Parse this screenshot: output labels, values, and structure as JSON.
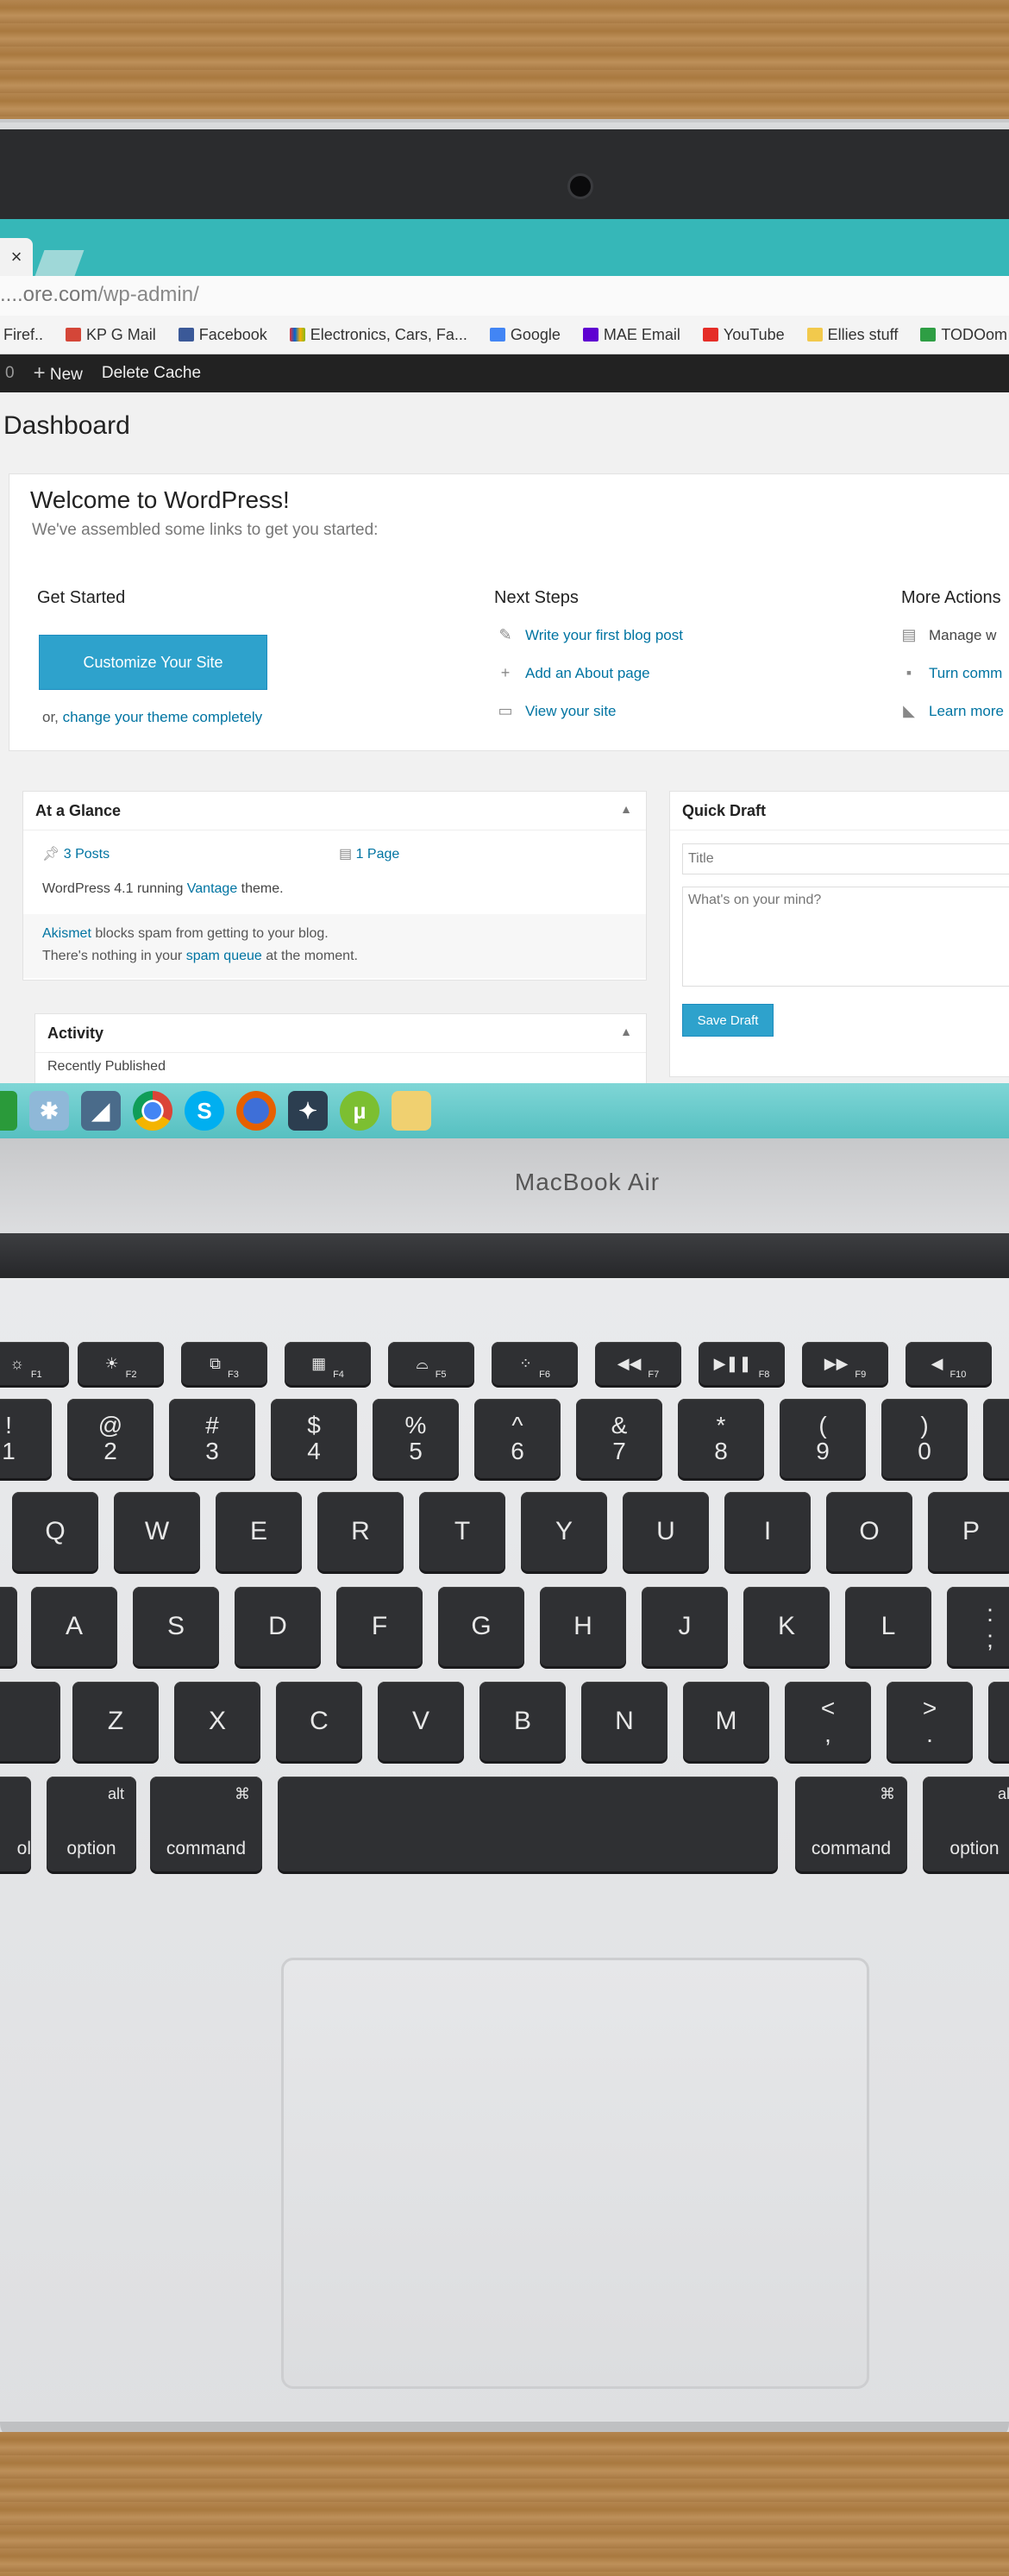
{
  "browser": {
    "tab_close": "×",
    "url_host": "....ore.com",
    "url_path": "/wp-admin/",
    "bookmarks": [
      {
        "label": "Firef..",
        "icon": "firefox-icon",
        "color": "#e66000"
      },
      {
        "label": "KP G Mail",
        "icon": "gmail-icon",
        "color": "#d44638"
      },
      {
        "label": "Facebook",
        "icon": "facebook-icon",
        "color": "#3b5998"
      },
      {
        "label": "Electronics, Cars, Fa...",
        "icon": "ebay-icon",
        "color": "#e53238"
      },
      {
        "label": "Google",
        "icon": "google-icon",
        "color": "#4285f4"
      },
      {
        "label": "MAE Email",
        "icon": "yahoo-icon",
        "color": "#5f01d1"
      },
      {
        "label": "YouTube",
        "icon": "youtube-icon",
        "color": "#e52d27"
      },
      {
        "label": "Ellies stuff",
        "icon": "folder-icon",
        "color": "#f2c94c"
      },
      {
        "label": "TODOom - You",
        "icon": "todo-icon",
        "color": "#2e9e44"
      }
    ]
  },
  "adminbar": {
    "count": "0",
    "new_label": "New",
    "delete_cache": "Delete Cache"
  },
  "dashboard": {
    "title": "Dashboard",
    "welcome": {
      "heading": "Welcome to WordPress!",
      "subheading": "We've assembled some links to get you started:",
      "get_started": "Get Started",
      "customize_button": "Customize Your Site",
      "or_text": "or,",
      "change_theme_link": "change your theme completely",
      "next_steps": "Next Steps",
      "steps": [
        "Write your first blog post",
        "Add an About page",
        "View your site"
      ],
      "more_actions": "More Actions",
      "actions": [
        "Manage w",
        "Turn comm",
        "Learn more"
      ]
    },
    "glance": {
      "title": "At a Glance",
      "posts": "3 Posts",
      "pages": "1 Page",
      "version_pre": "WordPress 4.1 running",
      "theme": "Vantage",
      "version_post": "theme.",
      "akismet": "Akismet",
      "akismet_text": "blocks spam from getting to your blog.",
      "queue_pre": "There's nothing in your",
      "queue_link": "spam queue",
      "queue_post": "at the moment."
    },
    "activity": {
      "title": "Activity",
      "recently": "Recently Published"
    },
    "quick_draft": {
      "title": "Quick Draft",
      "title_placeholder": "Title",
      "content_placeholder": "What's on your mind?",
      "save_button": "Save Draft"
    }
  },
  "taskbar": [
    "start-icon",
    "pinwheel-icon",
    "bird-icon",
    "chrome-icon",
    "skype-icon",
    "firefox-icon",
    "bat-icon",
    "utorrent-icon",
    "folder-icon"
  ],
  "laptop": {
    "brand": "MacBook Air"
  },
  "keyboard": {
    "fn_row": [
      "F1",
      "F2",
      "F3",
      "F4",
      "F5",
      "F6",
      "F7",
      "F8",
      "F9",
      "F10"
    ],
    "fn_icons": [
      "☼",
      "☀",
      "⧉",
      "▦",
      "⌓",
      "⁘",
      "◀◀",
      "▶❚❚",
      "▶▶",
      "◀"
    ],
    "number_row": [
      [
        "!",
        "1"
      ],
      [
        "@",
        "2"
      ],
      [
        "#",
        "3"
      ],
      [
        "$",
        "4"
      ],
      [
        "%",
        "5"
      ],
      [
        "^",
        "6"
      ],
      [
        "&",
        "7"
      ],
      [
        "*",
        "8"
      ],
      [
        "(",
        "9"
      ],
      [
        ")",
        "0"
      ]
    ],
    "qwerty_row": [
      "Q",
      "W",
      "E",
      "R",
      "T",
      "Y",
      "U",
      "I",
      "O",
      "P"
    ],
    "home_row": [
      "A",
      "S",
      "D",
      "F",
      "G",
      "H",
      "J",
      "K",
      "L"
    ],
    "semicolon": [
      ":",
      ";"
    ],
    "bottom_row": [
      "Z",
      "X",
      "C",
      "V",
      "B",
      "N",
      "M"
    ],
    "comma": [
      "<",
      ","
    ],
    "period": [
      ">",
      "."
    ],
    "ctrl_partial": "ol",
    "alt_symbol": "alt",
    "option": "option",
    "cmd_symbol": "⌘",
    "command": "command"
  }
}
